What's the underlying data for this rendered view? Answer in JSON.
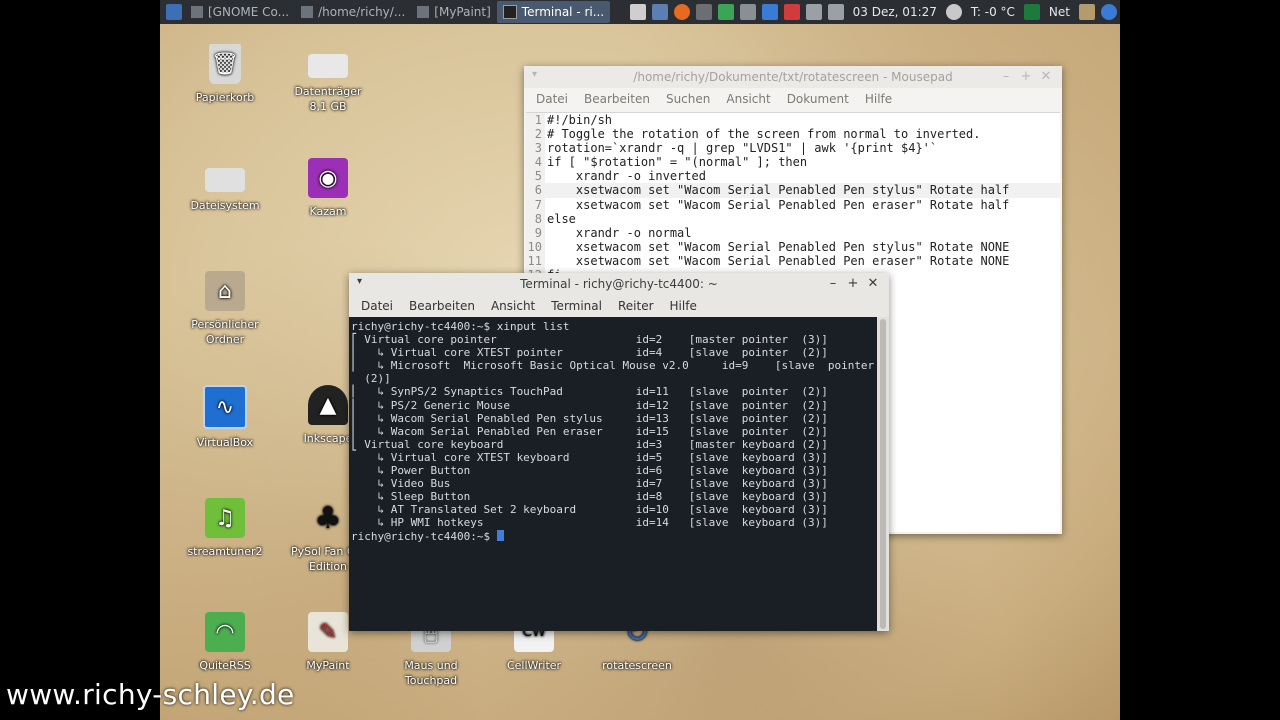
{
  "panel": {
    "tasks": [
      {
        "label": "[GNOME Co..."
      },
      {
        "label": "/home/richy/..."
      },
      {
        "label": "[MyPaint]"
      },
      {
        "label": "Terminal - ri..."
      }
    ],
    "datetime": "03 Dez, 01:27",
    "temperature": "T: -0 °C",
    "network": "Net"
  },
  "desktop_icons": [
    {
      "label": "Papierkorb",
      "icon": "trash-icon"
    },
    {
      "label": "Datenträger 8,1 GB",
      "icon": "drive-icon"
    },
    {
      "label": "Dateisystem",
      "icon": "filesystem-icon"
    },
    {
      "label": "Kazam",
      "icon": "camera-icon"
    },
    {
      "label": "Persönlicher Ordner",
      "icon": "home-folder-icon"
    },
    {
      "label": "VirtualBox",
      "icon": "virtualbox-icon"
    },
    {
      "label": "Inkscape",
      "icon": "inkscape-icon"
    },
    {
      "label": "streamtuner2",
      "icon": "streamtuner-icon"
    },
    {
      "label": "PySol Fan C... Edition",
      "icon": "cards-icon"
    },
    {
      "label": "QuiteRSS",
      "icon": "rss-icon"
    },
    {
      "label": "MyPaint",
      "icon": "paint-icon"
    },
    {
      "label": "Maus und Touchpad",
      "icon": "mouse-icon"
    },
    {
      "label": "CellWriter",
      "icon": "cellwriter-icon"
    },
    {
      "label": "rotatescreen",
      "icon": "rotate-icon"
    }
  ],
  "mousepad": {
    "title": "/home/richy/Dokumente/txt/rotatescreen - Mousepad",
    "menu": [
      "Datei",
      "Bearbeiten",
      "Suchen",
      "Ansicht",
      "Dokument",
      "Hilfe"
    ],
    "lines": [
      "#!/bin/sh",
      "# Toggle the rotation of the screen from normal to inverted.",
      "rotation=`xrandr -q | grep \"LVDS1\" | awk '{print $4}'`",
      "if [ \"$rotation\" = \"(normal\" ]; then",
      "    xrandr -o inverted",
      "    xsetwacom set \"Wacom Serial Penabled Pen stylus\" Rotate half",
      "    xsetwacom set \"Wacom Serial Penabled Pen eraser\" Rotate half",
      "else",
      "    xrandr -o normal",
      "    xsetwacom set \"Wacom Serial Penabled Pen stylus\" Rotate NONE",
      "    xsetwacom set \"Wacom Serial Penabled Pen eraser\" Rotate NONE",
      "fi"
    ]
  },
  "terminal": {
    "title": "Terminal - richy@richy-tc4400: ~",
    "menu": [
      "Datei",
      "Bearbeiten",
      "Ansicht",
      "Terminal",
      "Reiter",
      "Hilfe"
    ],
    "lines": [
      "richy@richy-tc4400:~$ xinput list",
      "⎡ Virtual core pointer                     id=2    [master pointer  (3)]",
      "⎜   ↳ Virtual core XTEST pointer           id=4    [slave  pointer  (2)]",
      "⎜   ↳ Microsoft  Microsoft Basic Optical Mouse v2.0     id=9    [slave  pointer",
      "  (2)]",
      "⎜   ↳ SynPS/2 Synaptics TouchPad           id=11   [slave  pointer  (2)]",
      "⎜   ↳ PS/2 Generic Mouse                   id=12   [slave  pointer  (2)]",
      "⎜   ↳ Wacom Serial Penabled Pen stylus     id=13   [slave  pointer  (2)]",
      "⎜   ↳ Wacom Serial Penabled Pen eraser     id=15   [slave  pointer  (2)]",
      "⎣ Virtual core keyboard                    id=3    [master keyboard (2)]",
      "    ↳ Virtual core XTEST keyboard          id=5    [slave  keyboard (3)]",
      "    ↳ Power Button                         id=6    [slave  keyboard (3)]",
      "    ↳ Video Bus                            id=7    [slave  keyboard (3)]",
      "    ↳ Sleep Button                         id=8    [slave  keyboard (3)]",
      "    ↳ AT Translated Set 2 keyboard         id=10   [slave  keyboard (3)]",
      "    ↳ HP WMI hotkeys                       id=14   [slave  keyboard (3)]"
    ],
    "prompt": "richy@richy-tc4400:~$ "
  },
  "watermark": "www.richy-schley.de"
}
